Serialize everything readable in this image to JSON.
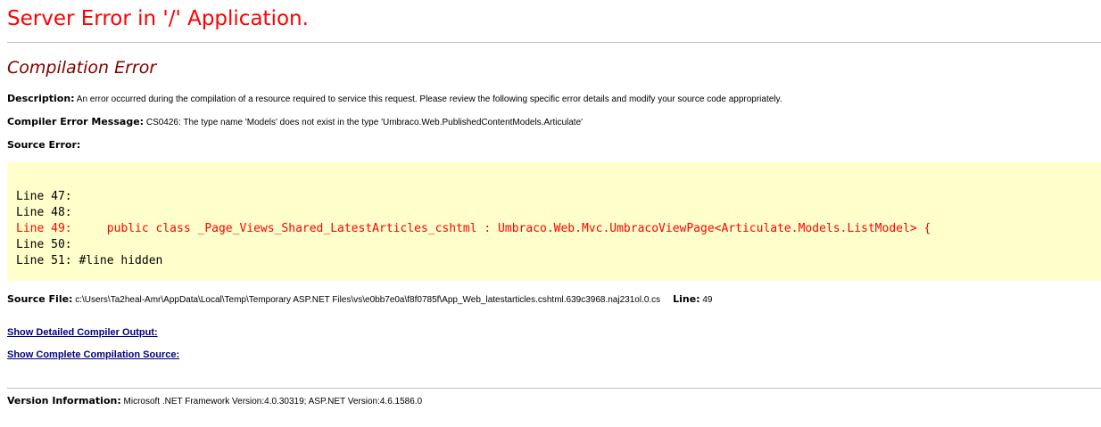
{
  "header": {
    "title": "Server Error in '/' Application.",
    "subtitle": "Compilation Error"
  },
  "description": {
    "label": "Description:",
    "text": "An error occurred during the compilation of a resource required to service this request. Please review the following specific error details and modify your source code appropriately."
  },
  "compiler_message": {
    "label": "Compiler Error Message:",
    "text": "CS0426: The type name 'Models' does not exist in the type 'Umbraco.Web.PublishedContentModels.Articulate'"
  },
  "source_error": {
    "label": "Source Error:",
    "lines": [
      {
        "text": "Line 47:",
        "is_error": false
      },
      {
        "text": "Line 48:",
        "is_error": false
      },
      {
        "text": "Line 49:     public class _Page_Views_Shared_LatestArticles_cshtml : Umbraco.Web.Mvc.UmbracoViewPage<Articulate.Models.ListModel> {",
        "is_error": true
      },
      {
        "text": "Line 50:",
        "is_error": false
      },
      {
        "text": "Line 51: #line hidden",
        "is_error": false
      }
    ]
  },
  "source_file": {
    "label": "Source File:",
    "path": "c:\\Users\\Ta2heal-Amr\\AppData\\Local\\Temp\\Temporary ASP.NET Files\\vs\\e0bb7e0a\\f8f0785f\\App_Web_latestarticles.cshtml.639c3968.naj231ol.0.cs",
    "line_label": "Line:",
    "line_value": "49"
  },
  "links": {
    "detailed_output": "Show Detailed Compiler Output:",
    "complete_source": "Show Complete Compilation Source:"
  },
  "version": {
    "label": "Version Information:",
    "text": "Microsoft .NET Framework Version:4.0.30319; ASP.NET Version:4.6.1586.0"
  },
  "colors": {
    "title": "#ff0000",
    "subtitle": "#800000",
    "code_background": "#ffffcc",
    "error_line": "#ff0000",
    "link": "#000080"
  }
}
